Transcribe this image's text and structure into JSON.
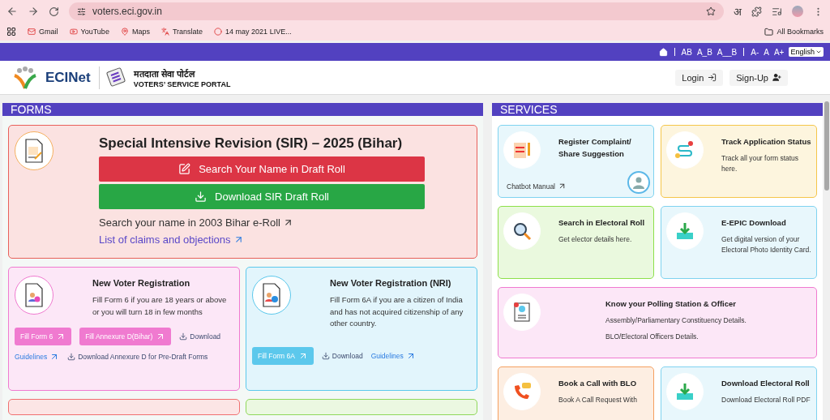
{
  "browser": {
    "address": "voters.eci.gov.in",
    "profile_letter": "अ",
    "bookmarks": [
      {
        "label": "Gmail"
      },
      {
        "label": "YouTube"
      },
      {
        "label": "Maps"
      },
      {
        "label": "Translate"
      },
      {
        "label": "14 may 2021 LIVE..."
      }
    ],
    "all_bookmarks": "All Bookmarks"
  },
  "topbar": {
    "contrast": [
      "AB",
      "A_B",
      "A__B"
    ],
    "sizes": [
      "A-",
      "A",
      "A+"
    ],
    "language": "English"
  },
  "header": {
    "brand": "ECINet",
    "portal_hindi": "मतदाता सेवा पोर्टल",
    "portal_english": "VOTERS’ SERVICE PORTAL",
    "login": "Login",
    "signup": "Sign-Up"
  },
  "forms": {
    "title": "FORMS",
    "sir": {
      "title": "Special Intensive Revision (SIR) – 2025 (Bihar)",
      "color": "#e8605a",
      "buttons": [
        {
          "label": "Search Your Name in Draft Roll",
          "kind": "edit"
        },
        {
          "label": "Download SIR Draft Roll",
          "kind": "download"
        }
      ],
      "links": [
        {
          "label": "Search your name in 2003 Bihar e-Roll",
          "kind": "plain"
        },
        {
          "label": "List of claims and objections",
          "kind": "accent"
        }
      ]
    },
    "cards": [
      {
        "title": "New Voter Registration",
        "text": "Fill Form 6 if you are 18 years or above or you will turn 18 in few months",
        "color": "#f07ad0",
        "actions": [
          {
            "label": "Fill Form 6",
            "kind": "pill"
          },
          {
            "label": "Fill Annexure D(Bihar)",
            "kind": "pill"
          },
          {
            "label": "Download",
            "kind": "download"
          },
          {
            "label": "Guidelines",
            "kind": "link"
          },
          {
            "label": "Download Annexure D for Pre-Draft Forms",
            "kind": "download"
          }
        ]
      },
      {
        "title": "New Voter Registration (NRI)",
        "text": "Fill Form 6A if you are a citizen of India and has not acquired citizenship of any other country.",
        "color": "#5cc8ec",
        "actions": [
          {
            "label": "Fill Form 6A",
            "kind": "pill"
          },
          {
            "label": "Download",
            "kind": "download"
          },
          {
            "label": "Guidelines",
            "kind": "link"
          }
        ]
      }
    ],
    "partial_cards": [
      {
        "color": "#f07070"
      },
      {
        "color": "#8fd85a"
      }
    ]
  },
  "services": {
    "title": "SERVICES",
    "cards": [
      {
        "kind": "tile",
        "title": "Register Complaint/ Share Suggestion",
        "link": "Chatbot Manual",
        "color": "#7fd3f0"
      },
      {
        "kind": "tile",
        "title": "Track Application Status",
        "lines": [
          "Track all your form status here."
        ],
        "color": "#f5c64a"
      },
      {
        "kind": "tile",
        "title": "Search in Electoral Roll",
        "lines": [
          "Get elector details here."
        ],
        "color": "#8de04a"
      },
      {
        "kind": "tile",
        "title": "E-EPIC Download",
        "lines": [
          "Get digital version of your Electoral Photo Identity Card."
        ],
        "color": "#7fd3f0"
      },
      {
        "kind": "wide",
        "title": "Know your Polling Station & Officer",
        "lines": [
          "Assembly/Parliamentary Constituency Details.",
          "BLO/Electoral Officers Details."
        ],
        "color": "#f07ad0"
      },
      {
        "kind": "tile",
        "title": "Book a Call with BLO",
        "lines": [
          "Book A Call Request With"
        ],
        "color": "#f5a060"
      },
      {
        "kind": "tile",
        "title": "Download Electoral Roll",
        "lines": [
          "Download Electoral Roll PDF"
        ],
        "color": "#7fd3f0"
      }
    ]
  }
}
